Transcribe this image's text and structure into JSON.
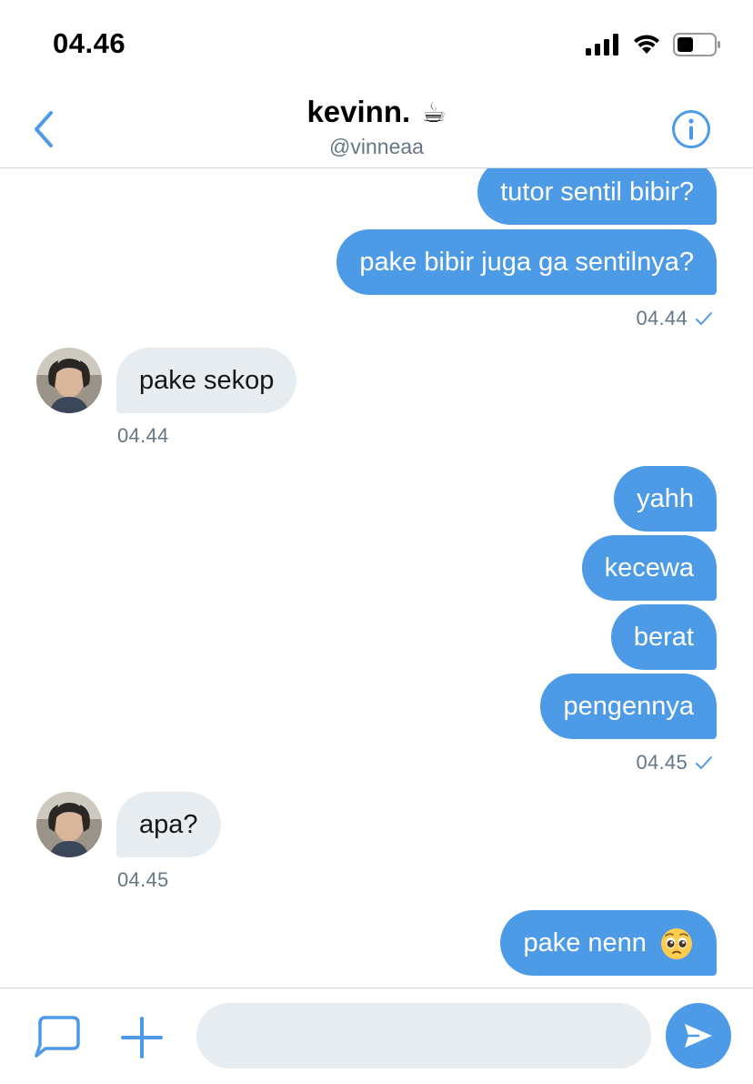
{
  "status_bar": {
    "time": "04.46"
  },
  "header": {
    "title": "kevinn.",
    "title_emoji": "☕",
    "handle": "@vinneaa"
  },
  "messages": {
    "m1": "tutor sentil bibir?",
    "m2": "pake bibir juga ga sentilnya?",
    "ts1": "04.44",
    "m3": "pake sekop",
    "ts2": "04.44",
    "m4": "yahh",
    "m5": "kecewa",
    "m6": "berat",
    "m7": "pengennya",
    "ts3": "04.45",
    "m8": "apa?",
    "ts4": "04.45",
    "m9": "pake nenn"
  },
  "composer": {
    "placeholder": ""
  },
  "colors": {
    "accent": "#4d9be6",
    "incoming_bubble": "#e6ecf0",
    "muted_text": "#657786"
  }
}
